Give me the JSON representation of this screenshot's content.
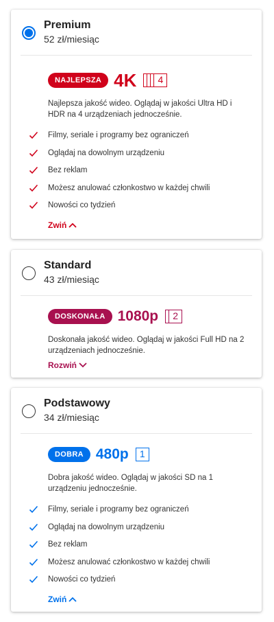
{
  "colors": {
    "premium": "#d0021b",
    "standard": "#a8104f",
    "basic": "#0071eb"
  },
  "plans": {
    "premium": {
      "name": "Premium",
      "price": "52 zł/miesiąc",
      "selected": true,
      "badge": "NAJLEPSZA",
      "resolution": "4K",
      "screens": "4",
      "description": "Najlepsza jakość wideo. Oglądaj w jakości Ultra HD i HDR na 4 urządzeniach jednocześnie.",
      "features": [
        "Filmy, seriale i programy bez ograniczeń",
        "Oglądaj na dowolnym urządzeniu",
        "Bez reklam",
        "Możesz anulować członkostwo w każdej chwili",
        "Nowości co tydzień"
      ],
      "toggle": "Zwiń",
      "toggle_icon": "chevron-up-icon"
    },
    "standard": {
      "name": "Standard",
      "price": "43 zł/miesiąc",
      "selected": false,
      "badge": "DOSKONAŁA",
      "resolution": "1080p",
      "screens": "2",
      "description": "Doskonała jakość wideo. Oglądaj w jakości Full HD na 2 urządzeniach jednocześnie.",
      "toggle": "Rozwiń",
      "toggle_icon": "chevron-down-icon"
    },
    "basic": {
      "name": "Podstawowy",
      "price": "34 zł/miesiąc",
      "selected": false,
      "badge": "DOBRA",
      "resolution": "480p",
      "screens": "1",
      "description": "Dobra jakość wideo. Oglądaj w jakości SD na 1 urządzeniu jednocześnie.",
      "features": [
        "Filmy, seriale i programy bez ograniczeń",
        "Oglądaj na dowolnym urządzeniu",
        "Bez reklam",
        "Możesz anulować członkostwo w każdej chwili",
        "Nowości co tydzień"
      ],
      "toggle": "Zwiń",
      "toggle_icon": "chevron-up-icon"
    }
  }
}
